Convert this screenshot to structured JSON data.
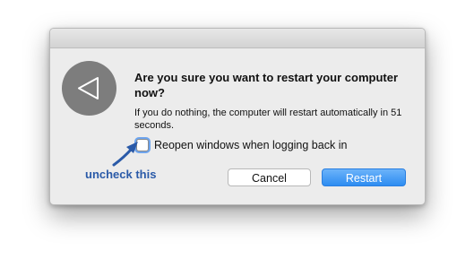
{
  "dialog": {
    "headline": "Are you sure you want to restart your computer now?",
    "body": "If you do nothing, the computer will restart automatically in 51 seconds.",
    "checkbox": {
      "label": "Reopen windows when logging back in",
      "checked": false
    },
    "cancel_label": "Cancel",
    "restart_label": "Restart",
    "icon": "restart-triangle-icon"
  },
  "annotation": {
    "text": "uncheck this",
    "color": "#2a5aa8"
  },
  "colors": {
    "accent": "#2d8cf1",
    "icon_background": "#7d7d7d"
  }
}
